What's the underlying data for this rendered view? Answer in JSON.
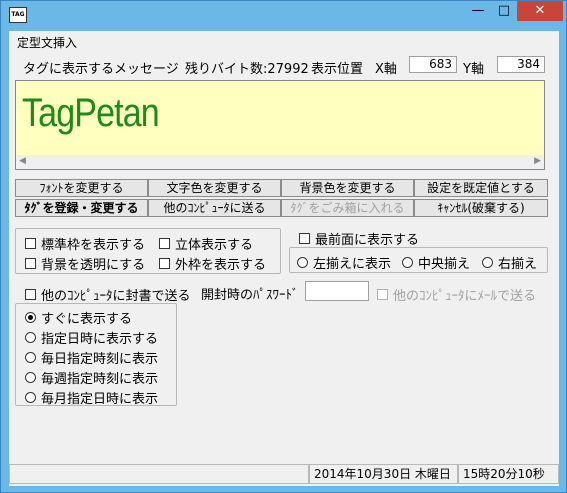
{
  "window": {
    "icon_text": "TAG",
    "min_glyph": "—",
    "max_glyph": "□",
    "close_glyph": "✕"
  },
  "menu": {
    "insert_template": "定型文挿入"
  },
  "info": {
    "message_label": "タグに表示するメッセージ",
    "remaining_label": "残りバイト数:27992",
    "position_label": "表示位置",
    "x_label": "X軸",
    "x_value": "683",
    "y_label": "Y軸",
    "y_value": "384"
  },
  "editor": {
    "text": "TagPetan"
  },
  "buttons": {
    "change_font": "ﾌｫﾝﾄを変更する",
    "change_text_color": "文字色を変更する",
    "change_bg_color": "背景色を変更する",
    "set_default": "設定を既定値とする",
    "register_tag": "ﾀｸﾞを登録・変更する",
    "send_other_pc": "他のｺﾝﾋﾟｭｰﾀに送る",
    "trash_tag": "ﾀｸﾞをごみ箱に入れる",
    "cancel": "ｷｬﾝｾﾙ(破棄する)"
  },
  "options": {
    "show_standard_frame": "標準枠を表示する",
    "show_3d": "立体表示する",
    "transparent_bg": "背景を透明にする",
    "show_outer_frame": "外枠を表示する",
    "topmost": "最前面に表示する",
    "align_left": "左揃えに表示",
    "align_center": "中央揃え",
    "align_right": "右揃え",
    "sealed_send": "他のｺﾝﾋﾟｭｰﾀに封書で送る",
    "password_label": "開封時のﾊﾟｽﾜｰﾄﾞ",
    "mail_send": "他のｺﾝﾋﾟｭｰﾀにﾒｰﾙで送る"
  },
  "schedule": {
    "items": [
      {
        "label": "すぐに表示する",
        "selected": true
      },
      {
        "label": "指定日時に表示する",
        "selected": false
      },
      {
        "label": "毎日指定時刻に表示",
        "selected": false
      },
      {
        "label": "毎週指定時刻に表示",
        "selected": false
      },
      {
        "label": "毎月指定日時に表示",
        "selected": false
      }
    ]
  },
  "status": {
    "date": "2014年10月30日 木曜日",
    "time": "15時20分10秒"
  },
  "colors": {
    "frame": "#6bb8e8",
    "close": "#c7453a",
    "editor_bg": "#ffffc0",
    "editor_text": "#1f8a17"
  }
}
